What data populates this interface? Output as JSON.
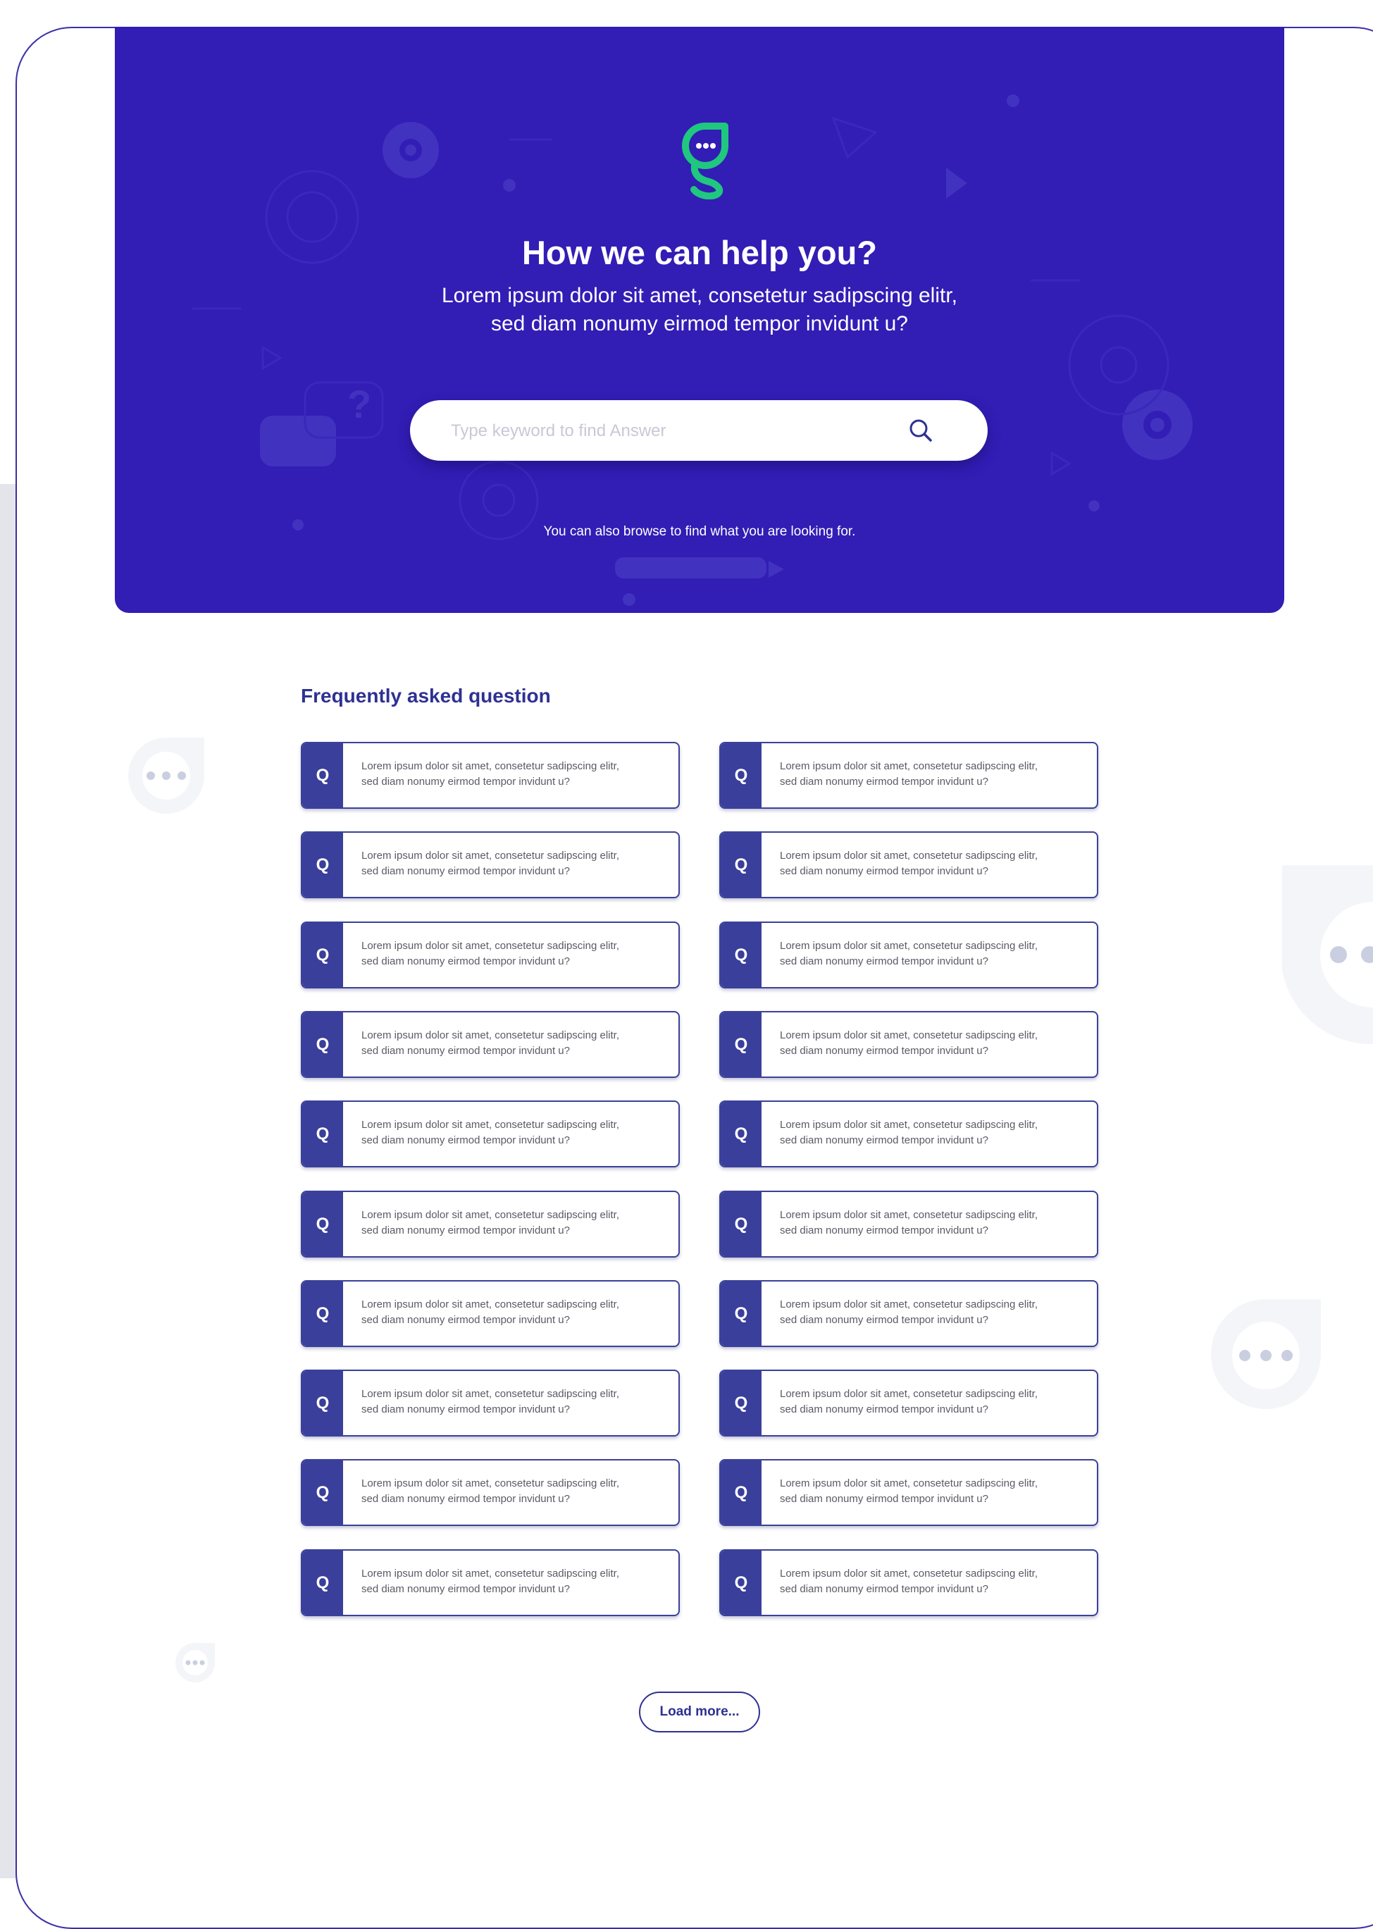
{
  "hero": {
    "title": "How we can help you?",
    "subtitle_line1": "Lorem ipsum dolor sit amet, consetetur sadipscing elitr,",
    "subtitle_line2": "sed diam nonumy eirmod tempor invidunt u?",
    "browse_text": "You can also browse to find what you are looking for."
  },
  "search": {
    "placeholder": "Type keyword to find Answer",
    "value": ""
  },
  "faq": {
    "title": "Frequently asked question",
    "badge": "Q",
    "items": [
      {
        "line1": "Lorem ipsum dolor sit amet, consetetur sadipscing elitr,",
        "line2": "sed diam nonumy eirmod tempor invidunt u?"
      },
      {
        "line1": "Lorem ipsum dolor sit amet, consetetur sadipscing elitr,",
        "line2": "sed diam nonumy eirmod tempor invidunt u?"
      },
      {
        "line1": "Lorem ipsum dolor sit amet, consetetur sadipscing elitr,",
        "line2": "sed diam nonumy eirmod tempor invidunt u?"
      },
      {
        "line1": "Lorem ipsum dolor sit amet, consetetur sadipscing elitr,",
        "line2": "sed diam nonumy eirmod tempor invidunt u?"
      },
      {
        "line1": "Lorem ipsum dolor sit amet, consetetur sadipscing elitr,",
        "line2": "sed diam nonumy eirmod tempor invidunt u?"
      },
      {
        "line1": "Lorem ipsum dolor sit amet, consetetur sadipscing elitr,",
        "line2": "sed diam nonumy eirmod tempor invidunt u?"
      },
      {
        "line1": "Lorem ipsum dolor sit amet, consetetur sadipscing elitr,",
        "line2": "sed diam nonumy eirmod tempor invidunt u?"
      },
      {
        "line1": "Lorem ipsum dolor sit amet, consetetur sadipscing elitr,",
        "line2": "sed diam nonumy eirmod tempor invidunt u?"
      },
      {
        "line1": "Lorem ipsum dolor sit amet, consetetur sadipscing elitr,",
        "line2": "sed diam nonumy eirmod tempor invidunt u?"
      },
      {
        "line1": "Lorem ipsum dolor sit amet, consetetur sadipscing elitr,",
        "line2": "sed diam nonumy eirmod tempor invidunt u?"
      },
      {
        "line1": "Lorem ipsum dolor sit amet, consetetur sadipscing elitr,",
        "line2": "sed diam nonumy eirmod tempor invidunt u?"
      },
      {
        "line1": "Lorem ipsum dolor sit amet, consetetur sadipscing elitr,",
        "line2": "sed diam nonumy eirmod tempor invidunt u?"
      },
      {
        "line1": "Lorem ipsum dolor sit amet, consetetur sadipscing elitr,",
        "line2": "sed diam nonumy eirmod tempor invidunt u?"
      },
      {
        "line1": "Lorem ipsum dolor sit amet, consetetur sadipscing elitr,",
        "line2": "sed diam nonumy eirmod tempor invidunt u?"
      },
      {
        "line1": "Lorem ipsum dolor sit amet, consetetur sadipscing elitr,",
        "line2": "sed diam nonumy eirmod tempor invidunt u?"
      },
      {
        "line1": "Lorem ipsum dolor sit amet, consetetur sadipscing elitr,",
        "line2": "sed diam nonumy eirmod tempor invidunt u?"
      },
      {
        "line1": "Lorem ipsum dolor sit amet, consetetur sadipscing elitr,",
        "line2": "sed diam nonumy eirmod tempor invidunt u?"
      },
      {
        "line1": "Lorem ipsum dolor sit amet, consetetur sadipscing elitr,",
        "line2": "sed diam nonumy eirmod tempor invidunt u?"
      },
      {
        "line1": "Lorem ipsum dolor sit amet, consetetur sadipscing elitr,",
        "line2": "sed diam nonumy eirmod tempor invidunt u?"
      },
      {
        "line1": "Lorem ipsum dolor sit amet, consetetur sadipscing elitr,",
        "line2": "sed diam nonumy eirmod tempor invidunt u?"
      }
    ],
    "load_more_label": "Load more..."
  },
  "icons": {
    "logo": "chat-logo-icon",
    "search": "search-icon",
    "decor_bubble": "chat-bubble-icon"
  },
  "colors": {
    "hero_bg": "#321db5",
    "accent_green": "#1fc77f",
    "navy": "#2e3192",
    "badge": "#3a3f9b",
    "muted_text": "#5a5a66"
  }
}
